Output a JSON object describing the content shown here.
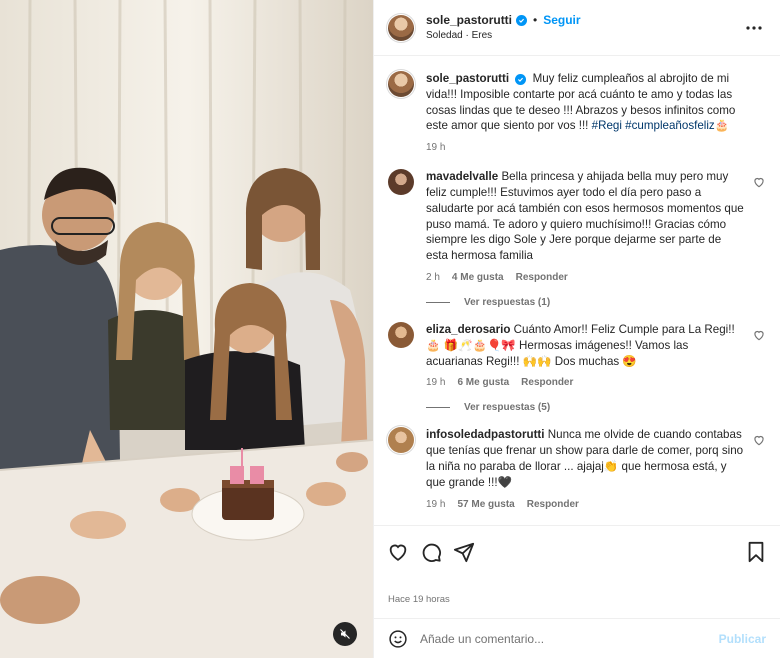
{
  "post": {
    "author": "sole_pastorutti",
    "follow_label": "Seguir",
    "audio": "Soledad · Eres",
    "caption_user": "sole_pastorutti",
    "caption_text": "Muy feliz cumpleaños al abrojito de mi vida!!! Imposible contarte por acá cuánto te amo y todas las cosas lindas que te deseo !!! Abrazos y besos infinitos como este amor que siento por vos !!!",
    "caption_tags": "#Regi #cumpleañosfeliz🎂",
    "caption_time": "19 h",
    "posted_ago": "Hace 19 horas"
  },
  "comments": [
    {
      "user": "mavadelvalle",
      "text": "Bella princesa y ahijada bella muy pero muy feliz cumple!!! Estuvimos ayer todo el día pero paso a saludarte por acá también con esos hermosos momentos que puso mamá. Te adoro y quiero muchísimo!!! Gracias cómo siempre les digo Sole y Jere porque dejarme ser parte de esta hermosa familia",
      "time": "2 h",
      "likes": "4 Me gusta",
      "reply": "Responder",
      "view_replies": "Ver respuestas (1)"
    },
    {
      "user": "eliza_derosario",
      "text": "Cuánto Amor!! Feliz Cumple para La Regi!! 🎂 🎁🥂🎂🎈🎀 Hermosas imágenes!! Vamos las acuarianas Regi!!! 🙌🙌 Dos muchas 😍",
      "time": "19 h",
      "likes": "6 Me gusta",
      "reply": "Responder",
      "view_replies": "Ver respuestas (5)"
    },
    {
      "user": "infosoledadpastorutti",
      "text": "Nunca me olvide de cuando contabas que tenías que frenar un show para darle de comer, porq sino la niña no paraba de llorar ... ajajaj👏 que hermosa está, y que grande !!!🖤",
      "time": "19 h",
      "likes": "57 Me gusta",
      "reply": "Responder"
    }
  ],
  "add_comment": {
    "placeholder": "Añade un comentario...",
    "publish_label": "Publicar"
  },
  "colors": {
    "link": "#0095f6",
    "text": "#262626",
    "muted": "#737373",
    "publish_disabled": "#b2dffc"
  },
  "icons": [
    "verified-icon",
    "more-options-icon",
    "heart-icon",
    "comment-icon",
    "share-icon",
    "bookmark-icon",
    "emoji-icon",
    "mute-icon"
  ]
}
